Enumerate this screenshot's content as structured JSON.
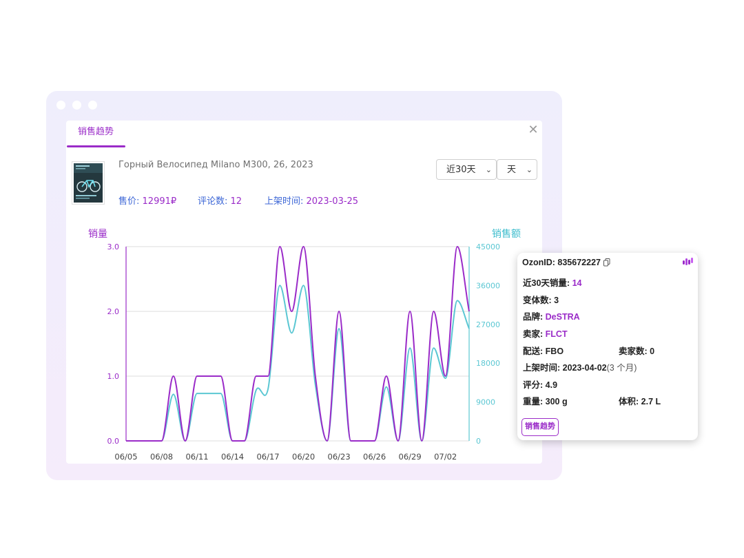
{
  "window": {
    "tab_label": "销售趋势"
  },
  "product": {
    "title": "Горный Велосипед Milano M300, 26, 2023",
    "price_label": "售价:",
    "price_value": "12991₽",
    "reviews_label": "评论数:",
    "reviews_value": "12",
    "listed_label": "上架时间:",
    "listed_value": "2023-03-25"
  },
  "controls": {
    "range": "近30天",
    "granularity": "天"
  },
  "colors": {
    "accent": "#9a2bc8",
    "sales_line": "#9a2bc8",
    "revenue_line": "#5bc7d3",
    "link_blue": "#3c66d6"
  },
  "chart_data": {
    "type": "line",
    "categories": [
      "06/05",
      "06/06",
      "06/07",
      "06/08",
      "06/09",
      "06/10",
      "06/11",
      "06/12",
      "06/13",
      "06/14",
      "06/15",
      "06/16",
      "06/17",
      "06/18",
      "06/19",
      "06/20",
      "06/21",
      "06/22",
      "06/23",
      "06/24",
      "06/25",
      "06/26",
      "06/27",
      "06/28",
      "06/29",
      "06/30",
      "07/01",
      "07/02",
      "07/03",
      "07/04"
    ],
    "x_tick_labels": [
      "06/05",
      "06/08",
      "06/11",
      "06/14",
      "06/17",
      "06/20",
      "06/23",
      "06/26",
      "06/29",
      "07/02"
    ],
    "y_left": {
      "label": "销量",
      "min": 0,
      "max": 3,
      "ticks": [
        "0.0",
        "1.0",
        "2.0",
        "3.0"
      ]
    },
    "y_right": {
      "label": "销售额",
      "min": 0,
      "max": 45000,
      "ticks": [
        "0",
        "9000",
        "18000",
        "27000",
        "36000",
        "45000"
      ]
    },
    "series": [
      {
        "name": "销量",
        "axis": "left",
        "color": "#9a2bc8",
        "values": [
          0,
          0,
          0,
          0,
          1,
          0,
          1,
          1,
          1,
          0,
          0,
          1,
          1,
          3,
          2,
          3,
          1,
          0,
          2,
          0,
          0,
          0,
          1,
          0,
          2,
          0,
          2,
          1,
          3,
          2
        ]
      },
      {
        "name": "销售额",
        "axis": "right",
        "color": "#5bc7d3",
        "values": [
          0,
          0,
          0,
          0,
          10800,
          0,
          11000,
          11000,
          11000,
          0,
          0,
          11800,
          12000,
          36000,
          25000,
          36000,
          13000,
          0,
          26000,
          0,
          0,
          0,
          12500,
          0,
          21500,
          0,
          21500,
          14500,
          32500,
          26000
        ]
      }
    ],
    "grid": true
  },
  "popup": {
    "ozon_label": "OzonID:",
    "ozon_value": "835672227",
    "rows": [
      {
        "label": "近30天销量:",
        "value": "14"
      },
      {
        "label": "变体数:",
        "value": "3"
      },
      {
        "label": "品牌:",
        "value": "DeSTRA"
      },
      {
        "label": "卖家:",
        "value": "FLCT"
      }
    ],
    "delivery_label": "配送:",
    "delivery_value": "FBO",
    "sellers_label": "卖家数:",
    "sellers_value": "0",
    "listed_label": "上架时间:",
    "listed_value": "2023-04-02",
    "listed_note": "(3 个月)",
    "rating_label": "评分:",
    "rating_value": "4.9",
    "weight_label": "重量:",
    "weight_value": "300 g",
    "volume_label": "体积:",
    "volume_value": "2.7 L",
    "button": "销售趋势"
  }
}
